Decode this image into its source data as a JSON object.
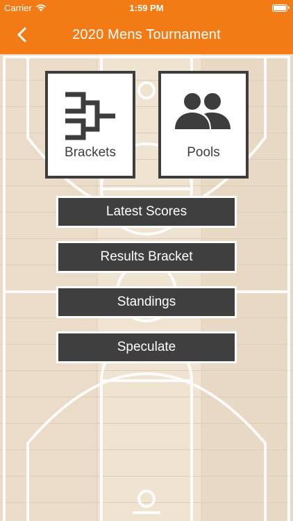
{
  "status_bar": {
    "carrier": "Carrier",
    "time": "1:59 PM"
  },
  "nav": {
    "title": "2020 Mens Tournament"
  },
  "tiles": [
    {
      "label": "Brackets",
      "icon": "bracket-icon"
    },
    {
      "label": "Pools",
      "icon": "people-icon"
    }
  ],
  "menu": [
    {
      "label": "Latest Scores"
    },
    {
      "label": "Results Bracket"
    },
    {
      "label": "Standings"
    },
    {
      "label": "Speculate"
    }
  ],
  "colors": {
    "accent": "#f37b16",
    "button": "#3f3f3f",
    "court": "#ecdfcd",
    "lines": "#ffffff"
  }
}
